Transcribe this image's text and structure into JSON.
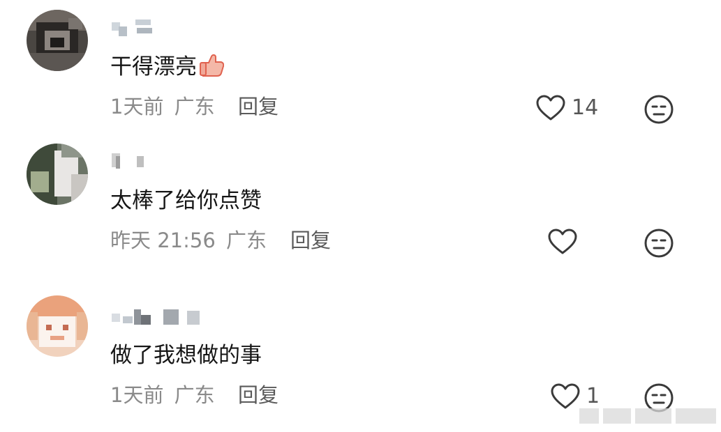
{
  "comments": [
    {
      "text": "干得漂亮",
      "time": "1天前",
      "location": "广东",
      "reply_label": "回复",
      "likes": "14",
      "has_thumb_emoji": true
    },
    {
      "text": "太棒了给你点赞",
      "time": "昨天 21:56",
      "location": "广东",
      "reply_label": "回复",
      "likes": ""
    },
    {
      "text": "做了我想做的事",
      "time": "1天前",
      "location": "广东",
      "reply_label": "回复",
      "likes": "1"
    }
  ],
  "icons": {
    "like": "heart-outline-icon",
    "dislike": "meh-face-icon",
    "emoji": "thumbs-up-emoji"
  },
  "colors": {
    "text": "#161616",
    "meta": "#8a8a8a",
    "reply": "#5a5a5a",
    "icon": "#3a3a3a"
  }
}
